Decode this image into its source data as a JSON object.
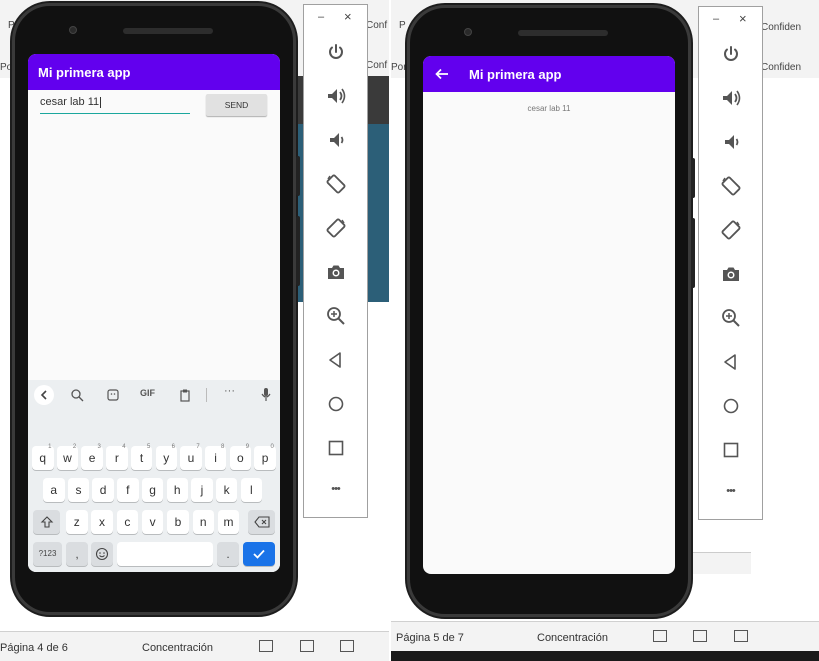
{
  "left": {
    "app_title": "Mi primera app",
    "input_value": "cesar lab 11",
    "send_label": "SEND",
    "ribbon": {
      "top_label": "Conf",
      "mid_label": "Conf",
      "p_label": "P",
      "po_label": "Po"
    },
    "status": {
      "page": "Página 4 de 6",
      "focus": "Concentración"
    },
    "keyboard": {
      "toolbar": [
        "GIF"
      ],
      "row1": [
        {
          "k": "q",
          "n": "1"
        },
        {
          "k": "w",
          "n": "2"
        },
        {
          "k": "e",
          "n": "3"
        },
        {
          "k": "r",
          "n": "4"
        },
        {
          "k": "t",
          "n": "5"
        },
        {
          "k": "y",
          "n": "6"
        },
        {
          "k": "u",
          "n": "7"
        },
        {
          "k": "i",
          "n": "8"
        },
        {
          "k": "o",
          "n": "9"
        },
        {
          "k": "p",
          "n": "0"
        }
      ],
      "row2": [
        "a",
        "s",
        "d",
        "f",
        "g",
        "h",
        "j",
        "k",
        "l"
      ],
      "row3": [
        "z",
        "x",
        "c",
        "v",
        "b",
        "n",
        "m"
      ],
      "sym_label": "?123",
      "comma": ",",
      "period": "."
    }
  },
  "right": {
    "app_title": "Mi primera app",
    "message": "cesar lab 11",
    "ribbon": {
      "top_label": "Confiden",
      "mid_label": "Confiden",
      "p_label": "P",
      "po_label": "Por"
    },
    "status": {
      "page": "Página 5 de 7",
      "focus": "Concentración"
    }
  },
  "emulator_toolbar": {
    "minimize": "–",
    "close": "×",
    "icons": [
      "power-icon",
      "volume-up-icon",
      "volume-down-icon",
      "rotate-left-icon",
      "rotate-right-icon",
      "camera-icon",
      "zoom-icon",
      "back-icon",
      "home-icon",
      "overview-icon",
      "more-icon"
    ],
    "more": "•••"
  },
  "colors": {
    "app_bar": "#6200ee",
    "input_underline": "#1aa79d",
    "enter_key": "#1a73e8",
    "toolbar_icon": "#555555"
  }
}
